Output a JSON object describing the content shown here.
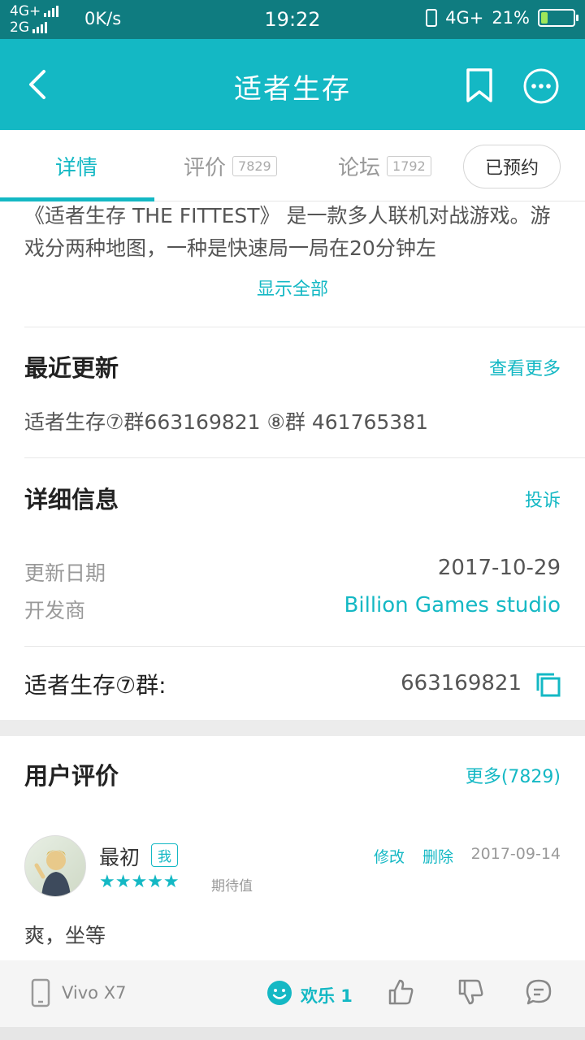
{
  "status_bar": {
    "net1": "4G+",
    "net2": "2G",
    "speed": "0K/s",
    "time": "19:22",
    "net_right": "4G+",
    "battery": "21%"
  },
  "app_bar": {
    "title": "适者生存"
  },
  "tabs": [
    {
      "label": "详情"
    },
    {
      "label": "评价",
      "count": "7829"
    },
    {
      "label": "论坛",
      "count": "1792"
    }
  ],
  "reserve_button": "已预约",
  "intro": {
    "text": "《适者生存 THE FITTEST》 是一款多人联机对战游戏。游戏分两种地图，一种是快速局一局在20分钟左",
    "show_all": "显示全部"
  },
  "recent_update": {
    "title": "最近更新",
    "more": "查看更多",
    "content": "适者生存⑦群663169821 ⑧群 461765381"
  },
  "details": {
    "title": "详细信息",
    "report": "投诉",
    "update_date_label": "更新日期",
    "update_date_value": "2017-10-29",
    "developer_label": "开发商",
    "developer_value": "Billion Games studio"
  },
  "group": {
    "label": "适者生存⑦群:",
    "value": "663169821"
  },
  "user_reviews": {
    "title": "用户评价",
    "more": "更多(7829)",
    "review": {
      "user": "最初",
      "badge": "我",
      "stars": "★★★★★",
      "rating_label": "期待值",
      "edit": "修改",
      "delete": "删除",
      "date": "2017-09-14",
      "text": "爽，坐等"
    }
  },
  "bottom_bar": {
    "device": "Vivo X7",
    "mood": "欢乐 1"
  },
  "colors": {
    "accent": "#14b8c4",
    "status_bar": "#0f7c80"
  }
}
